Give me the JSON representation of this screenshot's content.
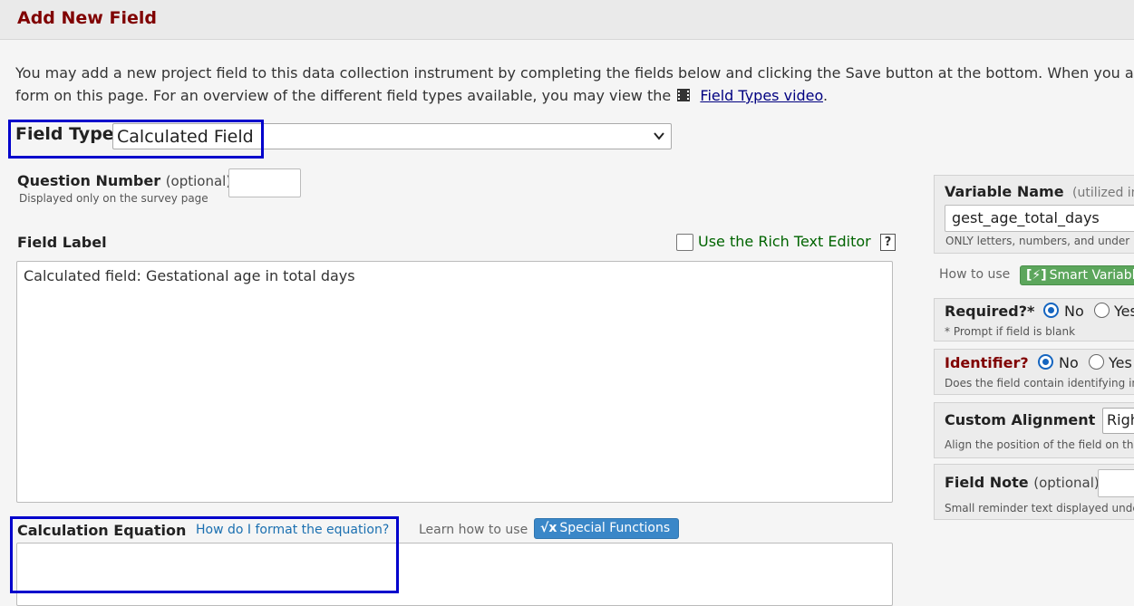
{
  "header": {
    "title": "Add New Field"
  },
  "intro": {
    "line1": "You may add a new project field to this data collection instrument by completing the fields below and clicking the Save button at the bottom. When you ad",
    "line2_prefix": "form on this page. For an overview of the different field types available, you may view the",
    "video_link": "Field Types video",
    "line2_suffix": "."
  },
  "field_type": {
    "label": "Field Type:",
    "selected": "Calculated Field"
  },
  "question_number": {
    "label": "Question Number",
    "optional": "(optional)",
    "hint": "Displayed only on the survey page",
    "value": ""
  },
  "field_label": {
    "label": "Field Label",
    "rich_text_label": "Use the Rich Text Editor",
    "help": "?",
    "value": "Calculated field: Gestational age in total days"
  },
  "calc_equation": {
    "label": "Calculation Equation",
    "help_link": "How do I format the equation?",
    "learn_label": "Learn how to use",
    "special_functions_label": "Special Functions",
    "value": ""
  },
  "variable_name": {
    "label": "Variable Name",
    "note": "(utilized in",
    "value": "gest_age_total_days",
    "hint": "ONLY letters, numbers, and under"
  },
  "smart_variables": {
    "how_to_use": "How to use",
    "label": "Smart Variabl"
  },
  "required": {
    "label": "Required?*",
    "no": "No",
    "yes": "Yes",
    "hint": "* Prompt if field is blank",
    "selected": "No"
  },
  "identifier": {
    "label": "Identifier?",
    "no": "No",
    "yes": "Yes",
    "hint": "Does the field contain identifying inf",
    "selected": "No"
  },
  "custom_alignment": {
    "label": "Custom Alignment",
    "value": "Righ",
    "hint": "Align the position of the field on the"
  },
  "field_note": {
    "label": "Field Note",
    "optional": "(optional)",
    "hint": "Small reminder text displayed under"
  },
  "colors": {
    "header_title": "#800000",
    "highlight": "#0000cc",
    "rte_green": "#006400",
    "link_blue": "#1a6fb0",
    "radio_blue": "#1565c0"
  }
}
